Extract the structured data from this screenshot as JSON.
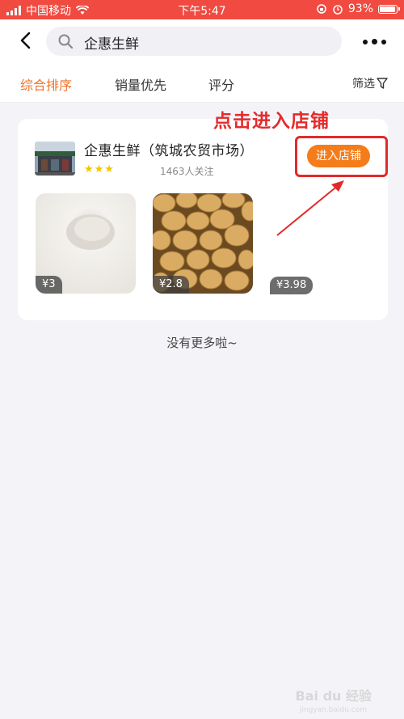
{
  "status_bar": {
    "carrier": "中国移动",
    "time": "下午5:47",
    "battery": "93%",
    "battery_level": 0.93
  },
  "header": {
    "search_query": "企惠生鲜"
  },
  "tabs": [
    {
      "label": "综合排序",
      "active": true
    },
    {
      "label": "销量优先",
      "active": false
    },
    {
      "label": "评分",
      "active": false
    }
  ],
  "filter_label": "筛选",
  "shop": {
    "name": "企惠生鲜（筑城农贸市场）",
    "stars": "★★★",
    "rating": 3,
    "followers": "1463人关注",
    "enter_label": "进入店铺",
    "products": [
      {
        "price": "¥3"
      },
      {
        "price": "¥2.8"
      },
      {
        "price": "¥3.98"
      }
    ]
  },
  "annotation": "点击进入店铺",
  "no_more": "没有更多啦~",
  "watermark": "Bai du 经验",
  "watermark_sub": "jingyan.baidu.com",
  "colors": {
    "status_bg": "#f14a40",
    "accent": "#f0722a",
    "button": "#f57c1a",
    "annotation": "#e52a2a"
  }
}
